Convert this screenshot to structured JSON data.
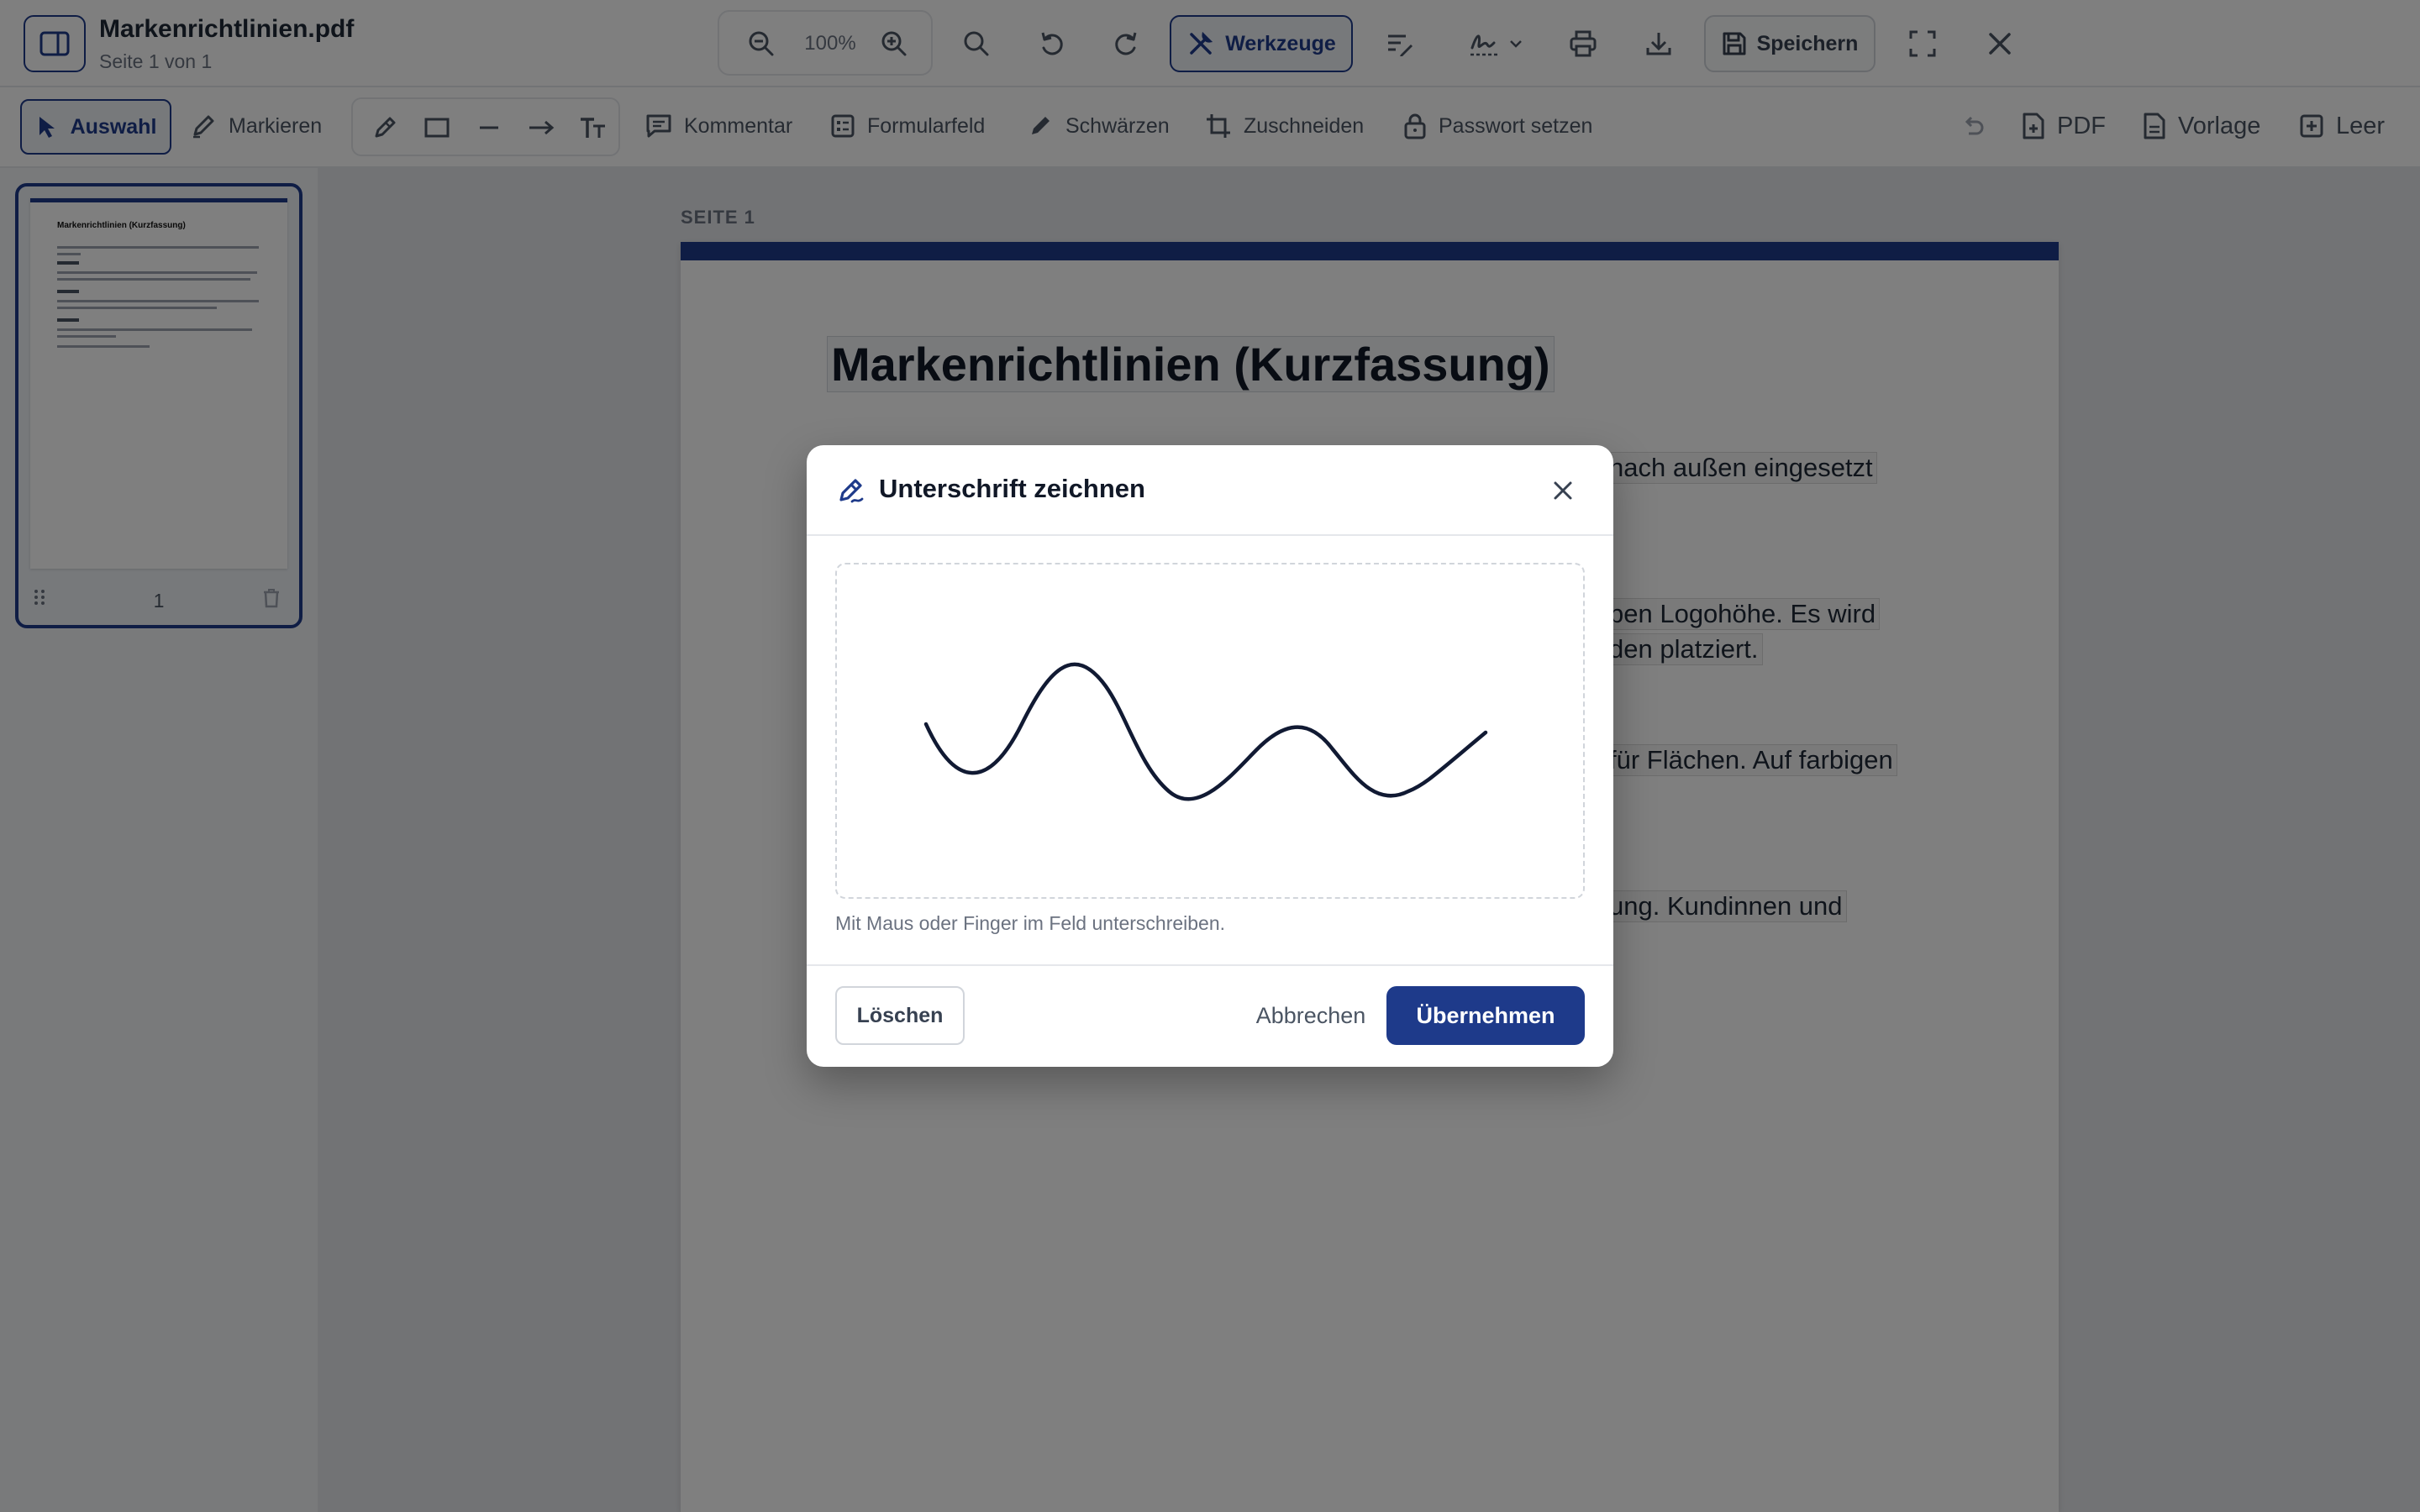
{
  "header": {
    "title": "Markenrichtlinien.pdf",
    "subtitle": "Seite 1 von 1",
    "zoom": "100%",
    "tools_label": "Werkzeuge",
    "save_label": "Speichern"
  },
  "toolbar": {
    "select_label": "Auswahl",
    "highlight_label": "Markieren",
    "comment_label": "Kommentar",
    "formfield_label": "Formularfeld",
    "redact_label": "Schwärzen",
    "crop_label": "Zuschneiden",
    "password_label": "Passwort setzen",
    "pdf_label": "PDF",
    "template_label": "Vorlage",
    "blank_label": "Leer"
  },
  "thumbnail": {
    "page_number": "1",
    "title": "Markenrichtlinien (Kurzfassung)"
  },
  "document": {
    "page_label": "SEITE 1",
    "heading": "Markenrichtlinien (Kurzfassung)",
    "visible_fragments": [
      "nach außen eingesetzt",
      "ben Logohöhe. Es wird",
      "den platziert.",
      "für Flächen. Auf farbigen",
      "ung. Kundinnen und"
    ]
  },
  "modal": {
    "title": "Unterschrift zeichnen",
    "hint": "Mit Maus oder Finger im Feld unterschreiben.",
    "clear_label": "Löschen",
    "cancel_label": "Abbrechen",
    "apply_label": "Übernehmen"
  },
  "colors": {
    "accent": "#1e3a8a",
    "signature_stroke": "#111a33"
  }
}
